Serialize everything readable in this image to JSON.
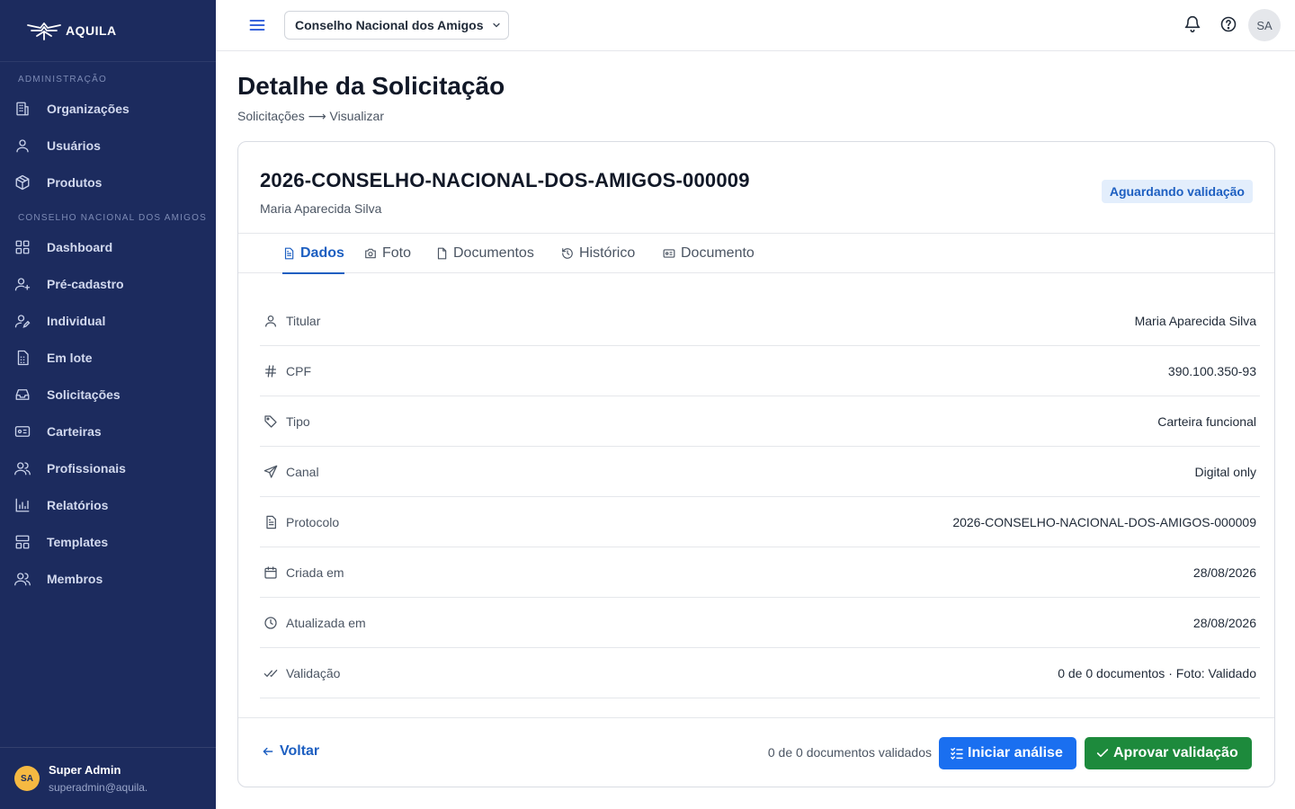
{
  "brand": {
    "name": "AQUILA"
  },
  "sidebar": {
    "sections": [
      {
        "title": "ADMINISTRAÇÃO",
        "items": [
          {
            "label": "Organizações",
            "icon": "building-icon"
          },
          {
            "label": "Usuários",
            "icon": "user-icon"
          },
          {
            "label": "Produtos",
            "icon": "package-icon"
          }
        ]
      },
      {
        "title": "CONSELHO NACIONAL DOS AMIGOS",
        "items": [
          {
            "label": "Dashboard",
            "icon": "dashboard-icon"
          },
          {
            "label": "Pré-cadastro",
            "icon": "user-plus-icon"
          },
          {
            "label": "Individual",
            "icon": "user-edit-icon"
          },
          {
            "label": "Em lote",
            "icon": "file-grid-icon"
          },
          {
            "label": "Solicitações",
            "icon": "inbox-icon"
          },
          {
            "label": "Carteiras",
            "icon": "id-card-icon"
          },
          {
            "label": "Profissionais",
            "icon": "users-icon"
          },
          {
            "label": "Relatórios",
            "icon": "bar-chart-icon"
          },
          {
            "label": "Templates",
            "icon": "layout-icon"
          },
          {
            "label": "Membros",
            "icon": "members-icon"
          }
        ]
      }
    ],
    "user": {
      "initials": "SA",
      "name": "Super Admin",
      "email": "superadmin@aquila."
    }
  },
  "topbar": {
    "org_selector": "Conselho Nacional dos Amigos",
    "avatar_initials": "SA"
  },
  "page": {
    "title": "Detalhe da Solicitação",
    "breadcrumb": "Solicitações ⟶ Visualizar"
  },
  "request": {
    "protocol_title": "2026-CONSELHO-NACIONAL-DOS-AMIGOS-000009",
    "holder_name": "Maria Aparecida Silva",
    "status": "Aguardando validação",
    "status_colors": {
      "bg": "#e3eefc",
      "text": "#1d5fc1"
    }
  },
  "tabs": [
    {
      "label": "Dados",
      "icon": "file-text-icon",
      "active": true
    },
    {
      "label": "Foto",
      "icon": "camera-icon",
      "active": false
    },
    {
      "label": "Documentos",
      "icon": "file-icon",
      "active": false
    },
    {
      "label": "Histórico",
      "icon": "history-icon",
      "active": false
    },
    {
      "label": "Documento",
      "icon": "id-card-icon",
      "active": false
    }
  ],
  "details": [
    {
      "label": "Titular",
      "value": "Maria Aparecida Silva",
      "icon": "user-icon"
    },
    {
      "label": "CPF",
      "value": "390.100.350-93",
      "icon": "hash-icon"
    },
    {
      "label": "Tipo",
      "value": "Carteira funcional",
      "icon": "tag-icon"
    },
    {
      "label": "Canal",
      "value": "Digital only",
      "icon": "send-icon"
    },
    {
      "label": "Protocolo",
      "value": "2026-CONSELHO-NACIONAL-DOS-AMIGOS-000009",
      "icon": "file-text-icon"
    },
    {
      "label": "Criada em",
      "value": "28/08/2026",
      "icon": "calendar-icon"
    },
    {
      "label": "Atualizada em",
      "value": "28/08/2026",
      "icon": "clock-icon"
    },
    {
      "label": "Validação",
      "value": "0 de 0 documentos · Foto: Validado",
      "icon": "double-check-icon"
    }
  ],
  "footer": {
    "back_label": "Voltar",
    "docs_validated": "0 de 0 documentos validados",
    "start_analysis_label": "Iniciar análise",
    "approve_label": "Aprovar validação"
  },
  "colors": {
    "sidebar_bg": "#1c2b5e",
    "primary": "#1a6ff0",
    "success": "#1d8a3c",
    "link": "#1d5fc1"
  }
}
